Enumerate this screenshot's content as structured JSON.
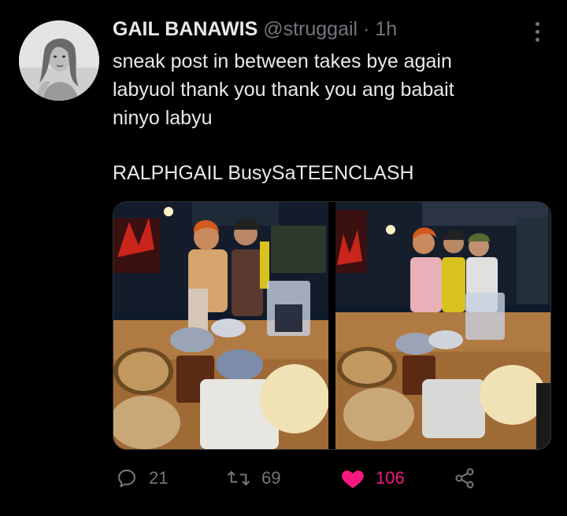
{
  "tweet": {
    "display_name": "GAIL BANAWIS",
    "handle": "@struggail",
    "separator": "·",
    "time": "1h",
    "text_lines": [
      "sneak post in between takes bye again",
      "labyuol thank you thank you ang babait",
      "ninyo labyu"
    ],
    "hashtags_line": "RALPHGAIL BusySaTEENCLASH"
  },
  "actions": {
    "reply": {
      "icon": "reply-icon",
      "count": "21"
    },
    "retweet": {
      "icon": "retweet-icon",
      "count": "69"
    },
    "like": {
      "icon": "heart-icon",
      "count": "106",
      "active": true,
      "color": "#f91880"
    },
    "share": {
      "icon": "share-icon"
    }
  },
  "colors": {
    "background": "#000000",
    "text_primary": "#e7e9ea",
    "text_secondary": "#71767b",
    "like_active": "#f91880"
  }
}
